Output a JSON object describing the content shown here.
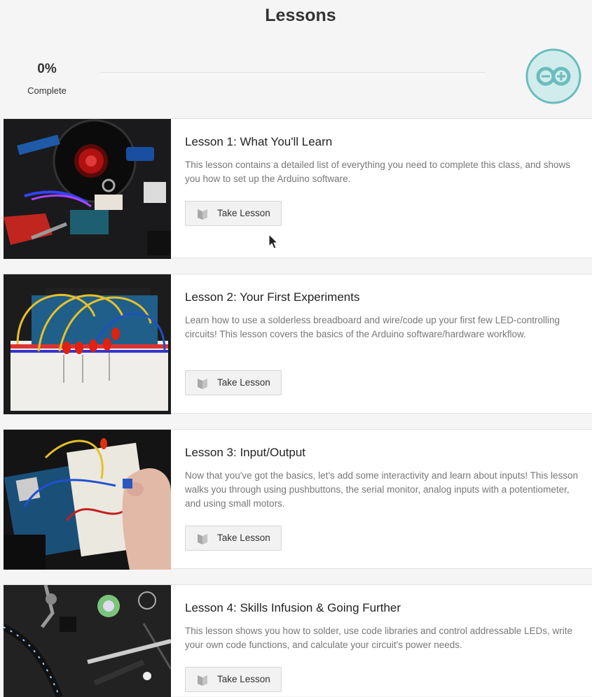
{
  "header": {
    "title": "Lessons",
    "progress": {
      "percent_text": "0%",
      "label": "Complete",
      "value": 0
    },
    "logo_icon": "arduino-infinity-logo-icon"
  },
  "colors": {
    "accent": "#00979c",
    "logo_bg": "#d1ecec",
    "logo_ring": "#6cbcbd"
  },
  "lessons": [
    {
      "title": "Lesson 1: What You'll Learn",
      "description": "This lesson contains a detailed list of everything you need to complete this class, and shows you how to set up the Arduino software.",
      "button_label": "Take Lesson",
      "button_icon": "book-icon"
    },
    {
      "title": "Lesson 2: Your First Experiments",
      "description": "Learn how to use a solderless breadboard and wire/code up your first few LED-controlling circuits! This lesson covers the basics of the Arduino software/hardware workflow.",
      "button_label": "Take Lesson",
      "button_icon": "book-icon"
    },
    {
      "title": "Lesson 3: Input/Output",
      "description": "Now that you've got the basics, let's add some interactivity and learn about inputs! This lesson walks you through using pushbuttons, the serial monitor, analog inputs with a potentiometer, and using small motors.",
      "button_label": "Take Lesson",
      "button_icon": "book-icon"
    },
    {
      "title": "Lesson 4: Skills Infusion & Going Further",
      "description": "This lesson shows you how to solder, use code libraries and control addressable LEDs, write your own code functions, and calculate your circuit's power needs.",
      "button_label": "Take Lesson",
      "button_icon": "book-icon"
    }
  ]
}
